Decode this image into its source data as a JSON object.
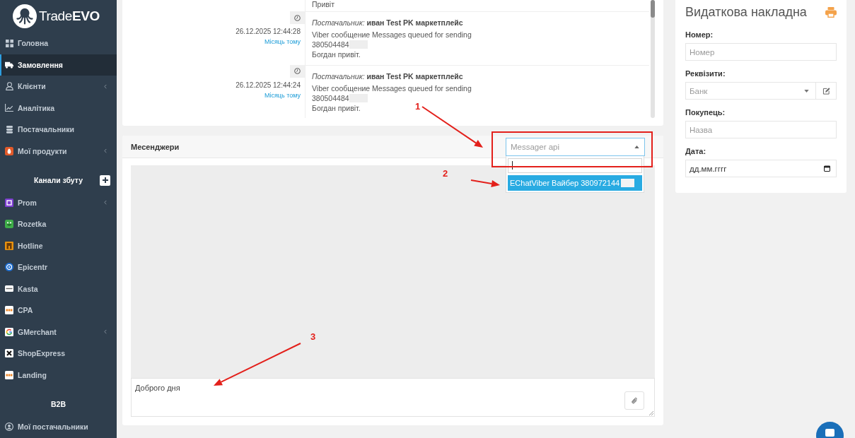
{
  "sidebar": {
    "brand": "Trade**EVO**",
    "sections": [
      {
        "items": [
          {
            "label": "Головна",
            "kind": "link",
            "selected": false
          },
          {
            "label": "Замовлення",
            "kind": "link",
            "selected": true
          },
          {
            "label": "Клієнти",
            "kind": "submenu",
            "selected": false
          },
          {
            "label": "Аналітика",
            "kind": "link",
            "selected": false
          },
          {
            "label": "Постачальники",
            "kind": "link",
            "selected": false
          },
          {
            "label": "Мої продукти",
            "kind": "submenu",
            "selected": false
          }
        ]
      },
      {
        "title": "Канали збуту",
        "add_button": true,
        "items": [
          {
            "label": "Prom",
            "kind": "submenu",
            "selected": false
          },
          {
            "label": "Rozetka",
            "kind": "link",
            "selected": false
          },
          {
            "label": "Hotline",
            "kind": "link",
            "selected": false
          },
          {
            "label": "Epicentr",
            "kind": "link",
            "selected": false
          },
          {
            "label": "Kasta",
            "kind": "link",
            "selected": false
          },
          {
            "label": "CPA",
            "kind": "link",
            "selected": false
          },
          {
            "label": "GMerchant",
            "kind": "submenu",
            "selected": false
          },
          {
            "label": "ShopExpress",
            "kind": "link",
            "selected": false
          },
          {
            "label": "Landing",
            "kind": "link",
            "selected": false
          }
        ]
      },
      {
        "title": "B2B",
        "items": [
          {
            "label": "Мої постачальники",
            "kind": "link",
            "selected": false
          }
        ]
      }
    ]
  },
  "messages_card": {
    "tail_line": "Привіт",
    "messages": [
      {
        "datetime": "26.12.2025 12:44:28",
        "relative": "Місяць тому",
        "supplier_label": "Постачальник:",
        "supplier": "иван Test PK маркетплейс",
        "text": "Viber сообщение Messages queued for sending",
        "phone": "380504484",
        "phone_redacted": true,
        "greeting": "Богдан привіт."
      },
      {
        "datetime": "26.12.2025 12:44:24",
        "relative": "Місяць тому",
        "supplier_label": "Постачальник:",
        "supplier": "иван Test PK маркетплейс",
        "text": "Viber сообщение Messages queued for sending",
        "phone": "380504484",
        "phone_redacted": true,
        "greeting": "Богдан привіт."
      }
    ]
  },
  "messengers": {
    "title": "Месенджери",
    "select": {
      "placeholder": "Messager api",
      "open": true,
      "options": [
        {
          "label": "EChatViber Вайбер 380972144",
          "selected": true,
          "redacted": true
        }
      ]
    },
    "message_box": {
      "value": "Доброго дня"
    }
  },
  "invoice": {
    "title": "Видаткова накладна",
    "fields": [
      {
        "label": "Номер:",
        "kind": "text",
        "placeholder": "Номер"
      },
      {
        "label": "Реквізити:",
        "kind": "select",
        "placeholder": "Банк"
      },
      {
        "label": "Покупець:",
        "kind": "text",
        "placeholder": "Назва"
      },
      {
        "label": "Дата:",
        "kind": "date",
        "placeholder": "дд.мм.гггг"
      }
    ]
  },
  "annotations": [
    {
      "number": "1"
    },
    {
      "number": "2"
    },
    {
      "number": "3"
    }
  ]
}
